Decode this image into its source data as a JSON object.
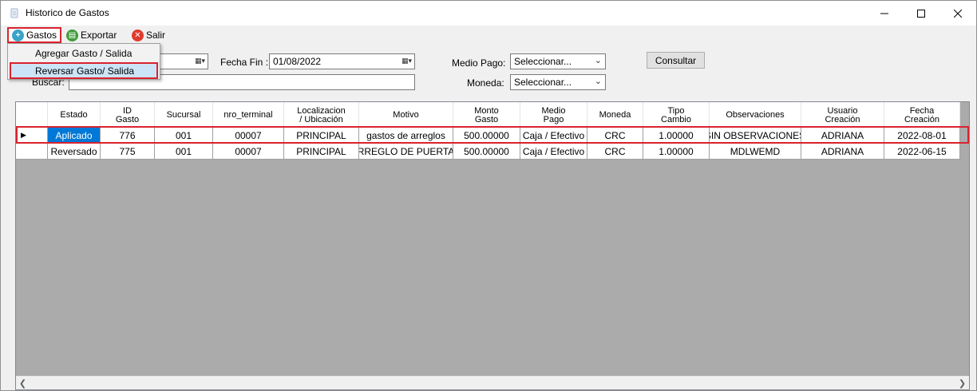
{
  "window": {
    "title": "Historico de Gastos",
    "minimize": "—",
    "maximize": "☐",
    "close": "✕"
  },
  "menu": {
    "gastos": "Gastos",
    "exportar": "Exportar",
    "salir": "Salir",
    "dropdown": [
      "Agregar Gasto / Salida",
      "Reversar Gasto/ Salida"
    ]
  },
  "filters": {
    "fecha_fin_label": "Fecha Fin :",
    "fecha_fin_value": "01/08/2022",
    "buscar_label": "Buscar:",
    "buscar_value": "",
    "medio_pago_label": "Medio Pago:",
    "medio_pago_value": "Seleccionar...",
    "moneda_label": "Moneda:",
    "moneda_value": "Seleccionar...",
    "consultar": "Consultar"
  },
  "grid": {
    "columns": [
      "Estado",
      "ID\nGasto",
      "Sucursal",
      "nro_terminal",
      "Localizacion\n/ Ubicación",
      "Motivo",
      "Monto\nGasto",
      "Medio\nPago",
      "Moneda",
      "Tipo\nCambio",
      "Observaciones",
      "Usuario\nCreación",
      "Fecha\nCreación"
    ],
    "rows": [
      [
        "Aplicado",
        "776",
        "001",
        "00007",
        "PRINCIPAL",
        "gastos de arreglos",
        "500.00000",
        "Caja / Efectivo",
        "CRC",
        "1.00000",
        "SIN OBSERVACIONES",
        "ADRIANA",
        "2022-08-01"
      ],
      [
        "Reversado",
        "775",
        "001",
        "00007",
        "PRINCIPAL",
        "RREGLO DE PUERTA",
        "500.00000",
        "Caja / Efectivo",
        "CRC",
        "1.00000",
        "MDLWEMD",
        "ADRIANA",
        "2022-06-15"
      ]
    ],
    "current_row_marker": "▶"
  },
  "colors": {
    "highlight_red": "#d9232e",
    "selection_blue": "#0078d7",
    "grid_background": "#ababab"
  }
}
